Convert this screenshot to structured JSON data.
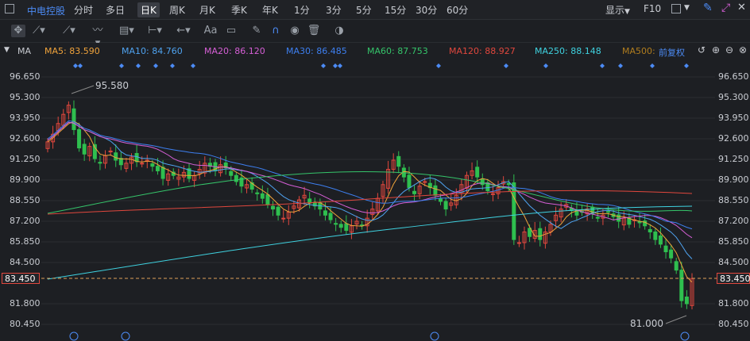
{
  "title": "中电控股",
  "periods": [
    "分时",
    "多日",
    "日K",
    "周K",
    "月K",
    "季K",
    "年K",
    "1分",
    "3分",
    "5分",
    "15分",
    "30分",
    "60分"
  ],
  "active_period": "日K",
  "right_tools": {
    "display": "显示",
    "f10": "F10"
  },
  "tools": [
    "move",
    "line",
    "channel",
    "wave",
    "fib",
    "measure",
    "arrow",
    "text",
    "comment",
    "pen",
    "magnet",
    "eye",
    "trash",
    "toggle"
  ],
  "toolbar_text": {
    "text_tool": "Aa"
  },
  "ma_label": "MA",
  "ma": [
    {
      "label": "MA5: 83.590",
      "color": "#f0a33b"
    },
    {
      "label": "MA10: 84.760",
      "color": "#4fa3f0"
    },
    {
      "label": "MA20: 86.120",
      "color": "#d65fd6"
    },
    {
      "label": "MA30: 86.485",
      "color": "#3d7ff0"
    },
    {
      "label": "MA60: 87.753",
      "color": "#35c46a"
    },
    {
      "label": "MA120: 88.927",
      "color": "#e0473d"
    },
    {
      "label": "MA250: 88.148",
      "color": "#3fd2e0"
    },
    {
      "label": "MA500:",
      "color": "#b07d1e"
    }
  ],
  "adjust": "前复权",
  "yticks": [
    "96.650",
    "95.300",
    "93.950",
    "92.600",
    "91.250",
    "89.900",
    "88.550",
    "87.200",
    "85.850",
    "84.500",
    "83.450",
    "81.800",
    "80.450"
  ],
  "current_price": "83.450",
  "high_label": "95.580",
  "low_label": "81.000",
  "colors": {
    "up": "#e0473d",
    "down": "#2fbf4f",
    "accent": "#4c8bf5"
  },
  "chart_data": {
    "type": "candlestick",
    "ylim": [
      80.2,
      97.0
    ],
    "yticks": [
      96.65,
      95.3,
      93.95,
      92.6,
      91.25,
      89.9,
      88.55,
      87.2,
      85.85,
      84.5,
      83.45,
      81.8,
      80.45
    ],
    "last_price": 83.45,
    "max_marker": 95.58,
    "min_marker": 81.0,
    "series_ma_latest": {
      "MA5": 83.59,
      "MA10": 84.76,
      "MA20": 86.12,
      "MA30": 86.485,
      "MA60": 87.753,
      "MA120": 88.927,
      "MA250": 88.148
    }
  }
}
